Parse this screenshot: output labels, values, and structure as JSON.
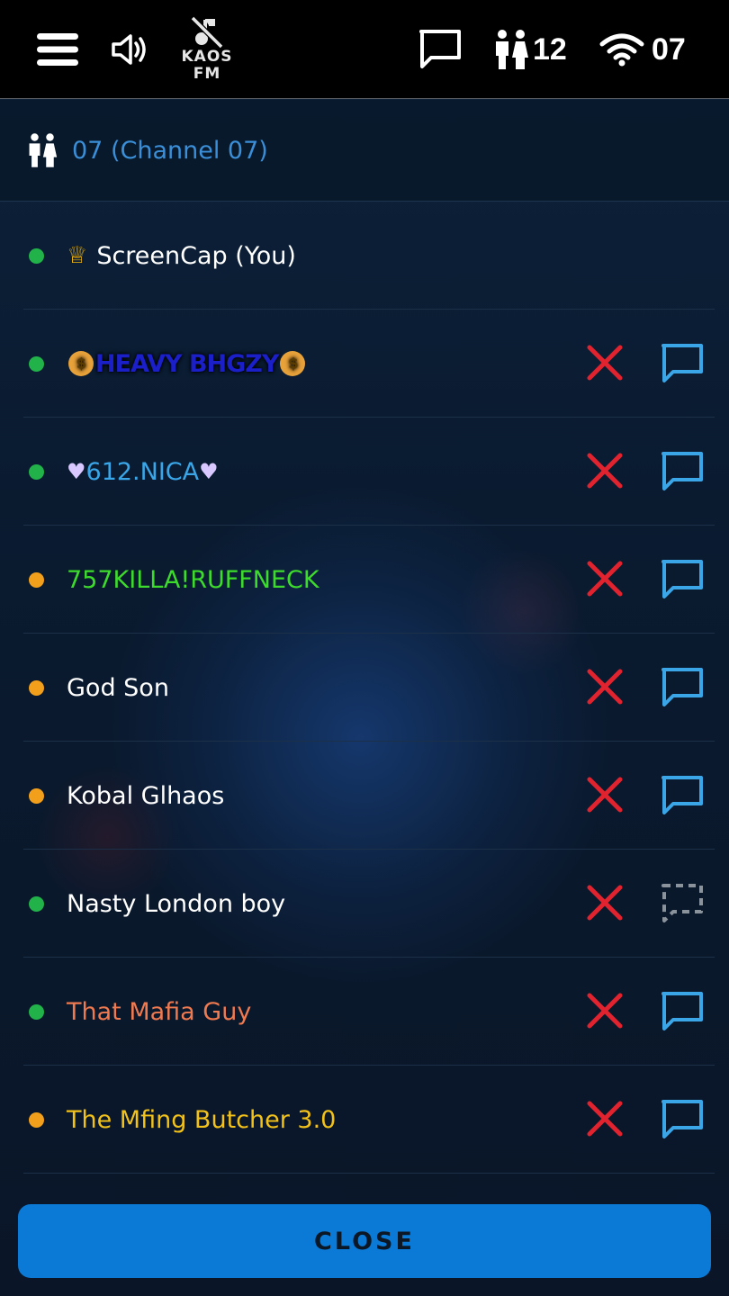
{
  "topbar": {
    "station_name": "KAOS FM",
    "users_count": "12",
    "channel_number": "07"
  },
  "channel": {
    "title": "07 (Channel 07)"
  },
  "users": [
    {
      "name": "ScreenCap (You)",
      "status": "online",
      "color": "#ffffff",
      "is_self": true
    },
    {
      "name": "HEAVY BHGZY",
      "status": "online",
      "color": "#1a1fc8"
    },
    {
      "name": "612.NICA",
      "status": "online",
      "color": "#3aa6e8"
    },
    {
      "name": "757KILLA!RUFFNECK",
      "status": "away",
      "color": "#3ddc2c"
    },
    {
      "name": "God Son",
      "status": "away",
      "color": "#ffffff"
    },
    {
      "name": "Kobal Glhaos",
      "status": "away",
      "color": "#ffffff"
    },
    {
      "name": "Nasty London boy",
      "status": "online",
      "color": "#ffffff",
      "messaging_disabled": true
    },
    {
      "name": "That Mafia Guy",
      "status": "online",
      "color": "#f07a50"
    },
    {
      "name": "The Mfing Butcher 3.0",
      "status": "away",
      "color": "#f2c21a"
    }
  ],
  "close_label": "CLOSE",
  "colors": {
    "accent": "#0a7ad6",
    "kick": "#e0232e",
    "message": "#3aa6e8",
    "online": "#22b24a",
    "away": "#f2a01b"
  }
}
